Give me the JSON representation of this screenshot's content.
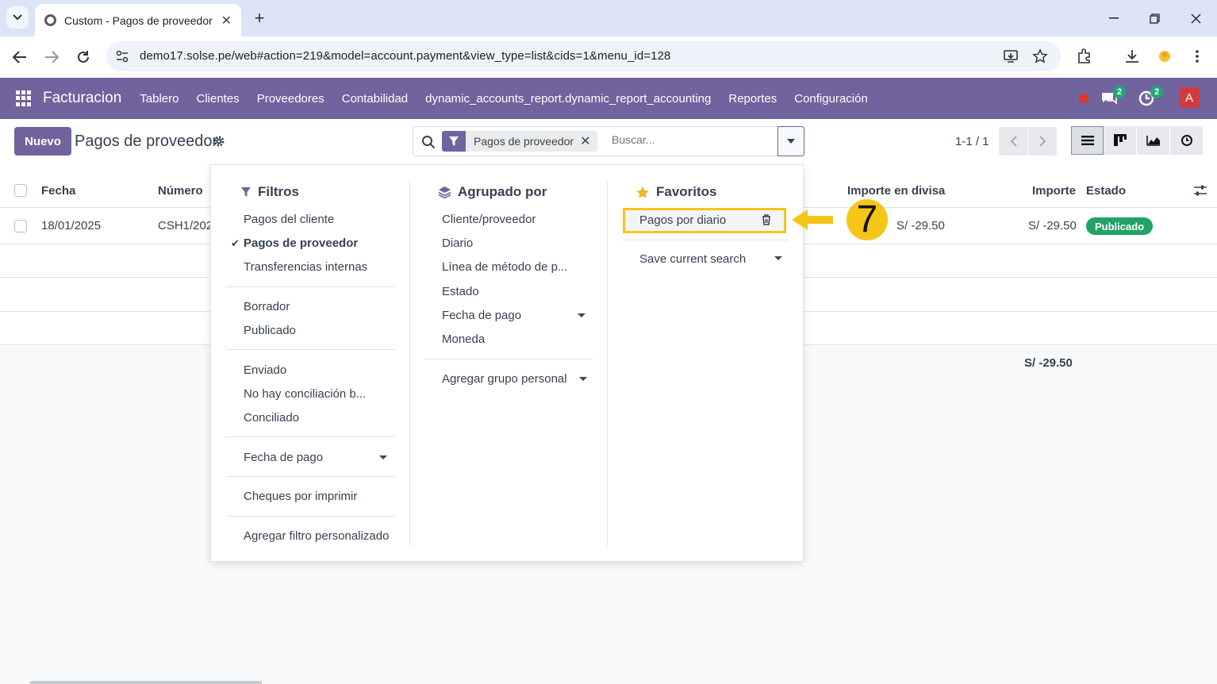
{
  "browser": {
    "tab_title": "Custom - Pagos de proveedor",
    "url": "demo17.solse.pe/web#action=219&model=account.payment&view_type=list&cids=1&menu_id=128"
  },
  "navbar": {
    "brand": "Facturacion",
    "menu": [
      "Tablero",
      "Clientes",
      "Proveedores",
      "Contabilidad",
      "dynamic_accounts_report.dynamic_report_accounting",
      "Reportes",
      "Configuración"
    ],
    "messages_count": "2",
    "activities_count": "2",
    "avatar_letter": "A"
  },
  "control_panel": {
    "new_button": "Nuevo",
    "title": "Pagos de proveedor",
    "facet": "Pagos de proveedor",
    "search_placeholder": "Buscar...",
    "pager": "1-1 / 1"
  },
  "list": {
    "headers": {
      "fecha": "Fecha",
      "numero": "Número",
      "importe_divisa": "Importe en divisa",
      "importe": "Importe",
      "estado": "Estado"
    },
    "row": {
      "fecha": "18/01/2025",
      "numero": "CSH1/202",
      "importe_divisa": "S/ -29.50",
      "importe": "S/ -29.50",
      "estado": "Publicado"
    },
    "total": "S/ -29.50"
  },
  "dropdown": {
    "filters": {
      "title": "Filtros",
      "group1": [
        "Pagos del cliente",
        "Pagos de proveedor",
        "Transferencias internas"
      ],
      "group2": [
        "Borrador",
        "Publicado"
      ],
      "group3": [
        "Enviado",
        "No hay conciliación b...",
        "Conciliado"
      ],
      "date_filter": "Fecha de pago",
      "cheques": "Cheques por imprimir",
      "custom": "Agregar filtro personalizado"
    },
    "groupby": {
      "title": "Agrupado por",
      "items": [
        "Cliente/proveedor",
        "Diario",
        "Línea de método de p...",
        "Estado",
        "Fecha de pago",
        "Moneda"
      ],
      "custom": "Agregar grupo personal"
    },
    "favorites": {
      "title": "Favoritos",
      "saved": "Pagos por diario",
      "save_current": "Save current search"
    }
  },
  "annotation": {
    "step": "7"
  },
  "colors": {
    "brand": "#71639e",
    "highlight": "#f5c518",
    "status_green": "#21a366"
  }
}
